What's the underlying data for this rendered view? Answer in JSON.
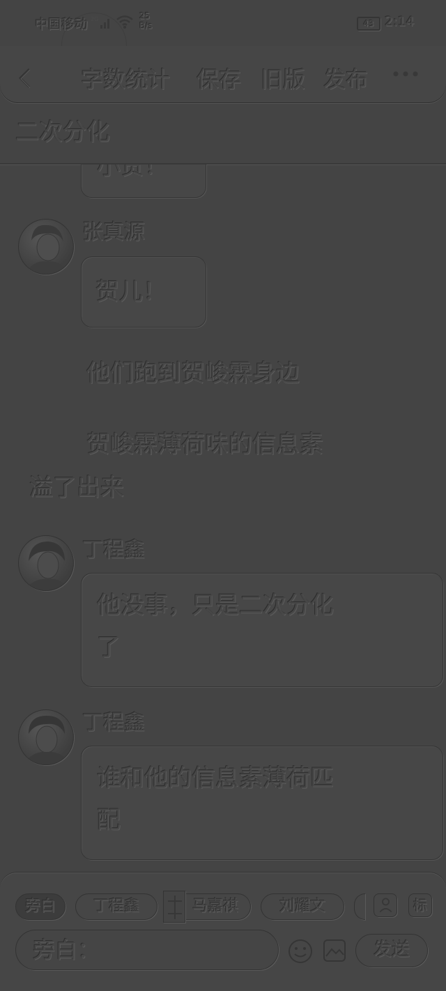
{
  "status_bar": {
    "carrier": "中国移动",
    "network_type": "4G",
    "speed_value": "25",
    "speed_unit": "B/s",
    "battery": "43",
    "time": "2:14"
  },
  "toolbar": {
    "word_count": "字数统计",
    "save": "保存",
    "old_version": "旧版",
    "publish": "发布"
  },
  "chapter": {
    "title": "二次分化"
  },
  "messages": [
    {
      "type": "bubble_partial",
      "text": "小贺！"
    },
    {
      "type": "dialogue",
      "speaker": "张真源",
      "text": "贺儿！"
    },
    {
      "type": "narration",
      "text": "他们跑到贺峻霖身边"
    },
    {
      "type": "narration",
      "text": "贺峻霖薄荷味的信息素溢了出来",
      "line1": "贺峻霖薄荷味的信息素",
      "line2": "溢了出来"
    },
    {
      "type": "dialogue",
      "speaker": "丁程鑫",
      "line1": "他没事，只是二次分化",
      "line2": "了"
    },
    {
      "type": "dialogue",
      "speaker": "丁程鑫",
      "line1": "谁和他的信息素薄荷匹",
      "line2": "配"
    }
  ],
  "composer": {
    "roles": [
      "旁白",
      "丁程鑫",
      "马嘉祺",
      "刘耀文"
    ],
    "active_role": "旁白",
    "tag_button": "标",
    "placeholder": "旁白：",
    "send": "发送"
  }
}
